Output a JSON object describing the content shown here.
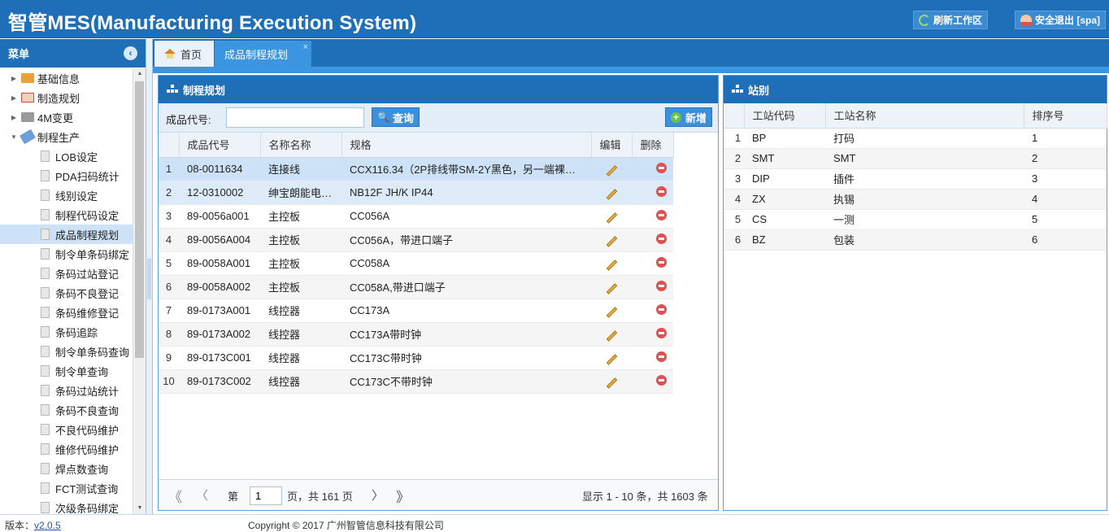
{
  "header": {
    "title": "智管MES(Manufacturing Execution System)",
    "refresh_label": "刷新工作区",
    "logout_label": "安全退出 [spa]"
  },
  "sidebar": {
    "title": "菜单",
    "groups": [
      {
        "label": "基础信息",
        "icon": "house-icon"
      },
      {
        "label": "制造规划",
        "icon": "calendar-icon"
      },
      {
        "label": "4M变更",
        "icon": "folder-icon"
      },
      {
        "label": "制程生产",
        "icon": "tools-icon"
      }
    ],
    "items": [
      "LOB设定",
      "PDA扫码统计",
      "线别设定",
      "制程代码设定",
      "成品制程规划",
      "制令单条码绑定",
      "条码过站登记",
      "条码不良登记",
      "条码维修登记",
      "条码追踪",
      "制令单条码查询",
      "制令单查询",
      "条码过站统计",
      "条码不良查询",
      "不良代码维护",
      "维修代码维护",
      "焊点数查询",
      "FCT测试查询",
      "次级条码绑定"
    ],
    "selected": "成品制程规划"
  },
  "tabs": {
    "home": "首页",
    "active": "成品制程规划",
    "close": "×"
  },
  "process_panel": {
    "title": "制程规划",
    "search_label": "成品代号:",
    "search_value": "",
    "query_label": "查询",
    "add_label": "新增",
    "columns": [
      "成品代号",
      "名称名称",
      "规格",
      "编辑",
      "删除"
    ],
    "rows": [
      {
        "n": "1",
        "code": "08-0011634",
        "name": "连接线",
        "spec": "CCX116.34（2P排线带SM-2Y黑色，另一端裸…"
      },
      {
        "n": "2",
        "code": "12-0310002",
        "name": "绅宝朗能电…",
        "spec": "NB12F JH/K IP44"
      },
      {
        "n": "3",
        "code": "89-0056a001",
        "name": "主控板",
        "spec": "CC056A"
      },
      {
        "n": "4",
        "code": "89-0056A004",
        "name": "主控板",
        "spec": "CC056A，带进口端子"
      },
      {
        "n": "5",
        "code": "89-0058A001",
        "name": "主控板",
        "spec": "CC058A"
      },
      {
        "n": "6",
        "code": "89-0058A002",
        "name": "主控板",
        "spec": "CC058A,带进口端子"
      },
      {
        "n": "7",
        "code": "89-0173A001",
        "name": "线控器",
        "spec": "CC173A"
      },
      {
        "n": "8",
        "code": "89-0173A002",
        "name": "线控器",
        "spec": "CC173A带时钟"
      },
      {
        "n": "9",
        "code": "89-0173C001",
        "name": "线控器",
        "spec": "CC173C带时钟"
      },
      {
        "n": "10",
        "code": "89-0173C002",
        "name": "线控器",
        "spec": "CC173C不带时钟"
      }
    ],
    "pager": {
      "first": "《",
      "prev": "〈",
      "page_prefix": "第",
      "page": "1",
      "page_suffix": "页，共 161 页",
      "next": "〉",
      "last": "》",
      "summary": "显示 1 - 10 条，共 1603 条"
    }
  },
  "station_panel": {
    "title": "站别",
    "columns": [
      "工站代码",
      "工站名称",
      "排序号"
    ],
    "rows": [
      {
        "n": "1",
        "code": "BP",
        "name": "打码",
        "order": "1"
      },
      {
        "n": "2",
        "code": "SMT",
        "name": "SMT",
        "order": "2"
      },
      {
        "n": "3",
        "code": "DIP",
        "name": "插件",
        "order": "3"
      },
      {
        "n": "4",
        "code": "ZX",
        "name": "执锡",
        "order": "4"
      },
      {
        "n": "5",
        "code": "CS",
        "name": "一测",
        "order": "5"
      },
      {
        "n": "6",
        "code": "BZ",
        "name": "包装",
        "order": "6"
      }
    ]
  },
  "footer": {
    "version_label": "版本：",
    "version": "v2.0.5",
    "copyright": "Copyright © 2017 广州智管信息科技有限公司"
  }
}
